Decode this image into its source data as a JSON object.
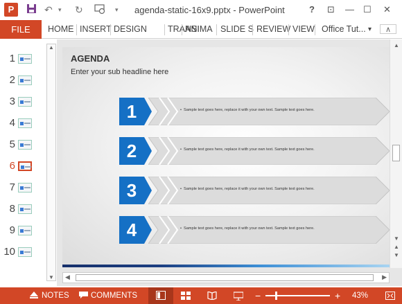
{
  "window": {
    "title": "agenda-static-16x9.pptx - PowerPoint",
    "app_logo": "P",
    "quick_access": [
      "save-icon",
      "undo-icon",
      "redo-icon",
      "slideshow-icon",
      "customize-icon"
    ],
    "controls": {
      "help": "?",
      "restore_ribbon": "⊡",
      "minimize": "—",
      "maximize": "☐",
      "close": "✕"
    }
  },
  "ribbon": {
    "file": "FILE",
    "tabs": [
      "HOME",
      "INSERT",
      "DESIGN",
      "TRANSI",
      "ANIMA",
      "SLIDE S",
      "REVIEW",
      "VIEW"
    ],
    "account": "Office Tut..."
  },
  "thumbnails": {
    "numbers": [
      "1",
      "2",
      "3",
      "4",
      "5",
      "6",
      "7",
      "8",
      "9",
      "10"
    ],
    "active_index": 6
  },
  "slide": {
    "title": "AGENDA",
    "subtitle": "Enter your sub headline here",
    "items": [
      {
        "number": "1",
        "text": "Sample text goes here, replace it with your own text. Sample text goes here."
      },
      {
        "number": "2",
        "text": "Sample text goes here, replace it with your own text. Sample text goes here."
      },
      {
        "number": "3",
        "text": "Sample text goes here, replace it with your own text. Sample text goes here."
      },
      {
        "number": "4",
        "text": "Sample text goes here, replace it with your own text. Sample text goes here."
      }
    ],
    "colors": {
      "number_box": "#1570c5",
      "banner": "#dcdcdc",
      "bar_dark": "#16306b",
      "bar_light": "#a9d5f2"
    }
  },
  "status": {
    "notes": "NOTES",
    "comments": "COMMENTS",
    "zoom_out": "−",
    "zoom_in": "+",
    "zoom": "43%",
    "zoom_level_percent": 43,
    "bar_color": "#d24726"
  }
}
